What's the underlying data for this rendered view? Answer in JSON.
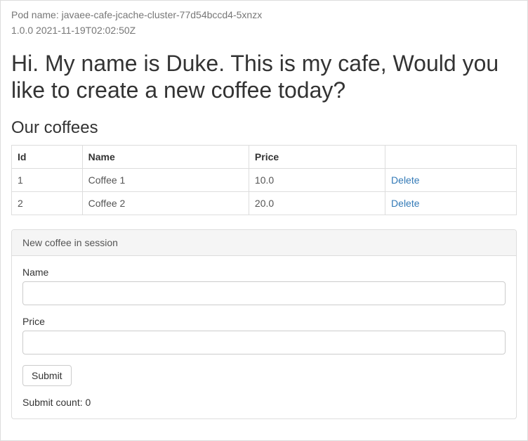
{
  "pod_name_label": "Pod name: ",
  "pod_name": "javaee-cafe-jcache-cluster-77d54bccd4-5xnzx",
  "build_info": "1.0.0 2021-11-19T02:02:50Z",
  "heading": "Hi. My name is Duke. This is my cafe, Would you like to create a new coffee today?",
  "our_coffees_heading": "Our coffees",
  "table": {
    "headers": {
      "id": "Id",
      "name": "Name",
      "price": "Price",
      "action": ""
    },
    "rows": [
      {
        "id": "1",
        "name": "Coffee 1",
        "price": "10.0",
        "delete": "Delete"
      },
      {
        "id": "2",
        "name": "Coffee 2",
        "price": "20.0",
        "delete": "Delete"
      }
    ]
  },
  "form": {
    "panel_title": "New coffee in session",
    "name_label": "Name",
    "price_label": "Price",
    "name_value": "",
    "price_value": "",
    "submit_label": "Submit",
    "submit_count_label": "Submit count: ",
    "submit_count": "0"
  }
}
